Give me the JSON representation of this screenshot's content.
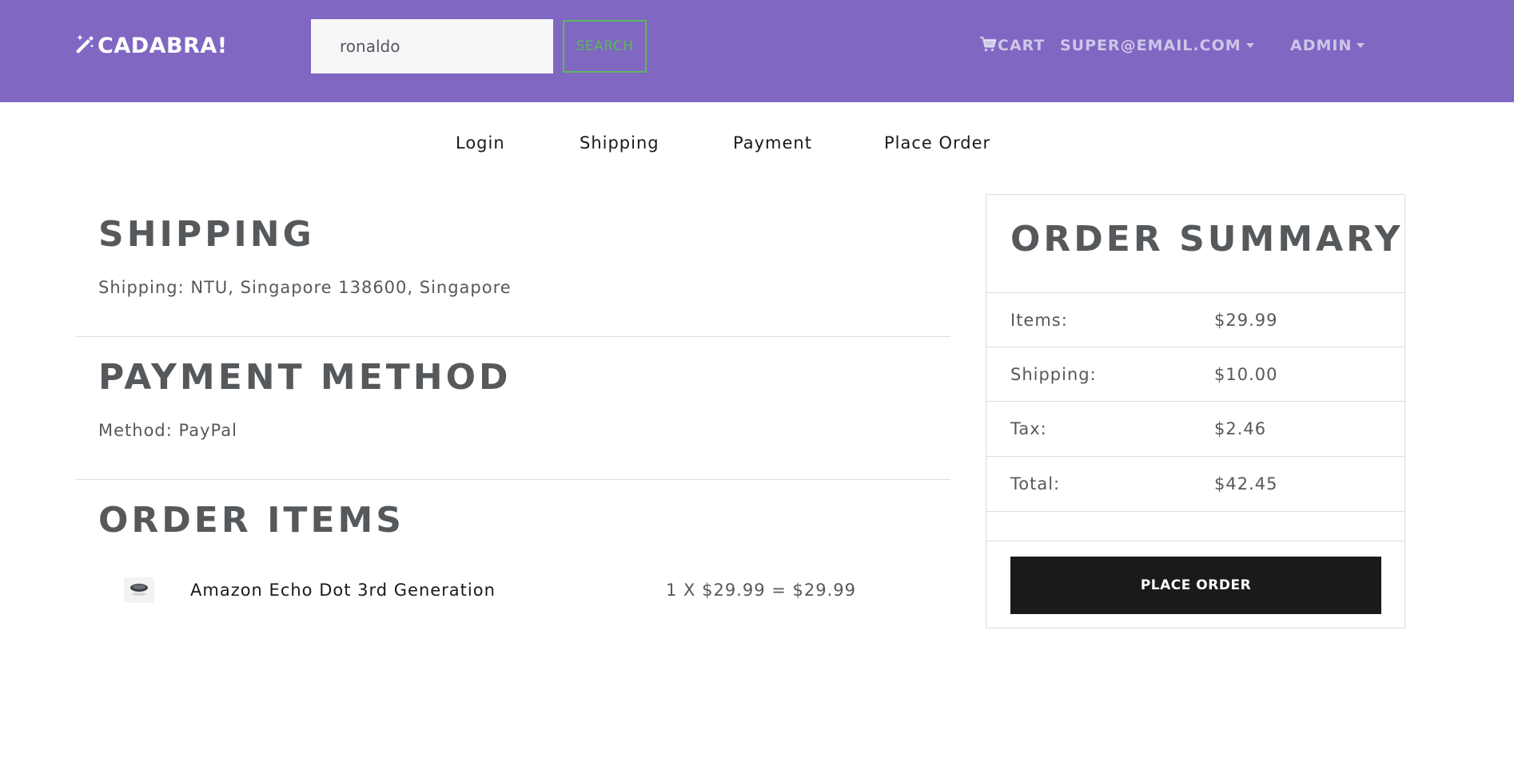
{
  "header": {
    "brand": "CADABRA!",
    "search": {
      "value": "ronaldo",
      "button_label": "SEARCH"
    },
    "cart_label": "CART",
    "user_menu_label": "SUPER@EMAIL.COM",
    "admin_menu_label": "ADMIN",
    "icons": {
      "brand": "magic-wand-icon",
      "cart": "shopping-cart-icon"
    },
    "colors": {
      "navbar_bg": "#7f67c2",
      "search_border": "#5cb85c"
    }
  },
  "steps": [
    {
      "label": "Login"
    },
    {
      "label": "Shipping"
    },
    {
      "label": "Payment"
    },
    {
      "label": "Place Order"
    }
  ],
  "shipping": {
    "title": "SHIPPING",
    "text": "Shipping: NTU, Singapore 138600, Singapore"
  },
  "payment": {
    "title": "PAYMENT METHOD",
    "text": "Method: PayPal"
  },
  "order_items": {
    "title": "ORDER ITEMS",
    "items": [
      {
        "name": "Amazon Echo Dot 3rd Generation",
        "price_text": "1 X $29.99 = $29.99"
      }
    ]
  },
  "summary": {
    "title": "ORDER SUMMARY",
    "rows": [
      {
        "label": "Items:",
        "value": "$29.99"
      },
      {
        "label": "Shipping:",
        "value": "$10.00"
      },
      {
        "label": "Tax:",
        "value": "$2.46"
      },
      {
        "label": "Total:",
        "value": "$42.45"
      }
    ],
    "place_order_label": "PLACE ORDER"
  }
}
